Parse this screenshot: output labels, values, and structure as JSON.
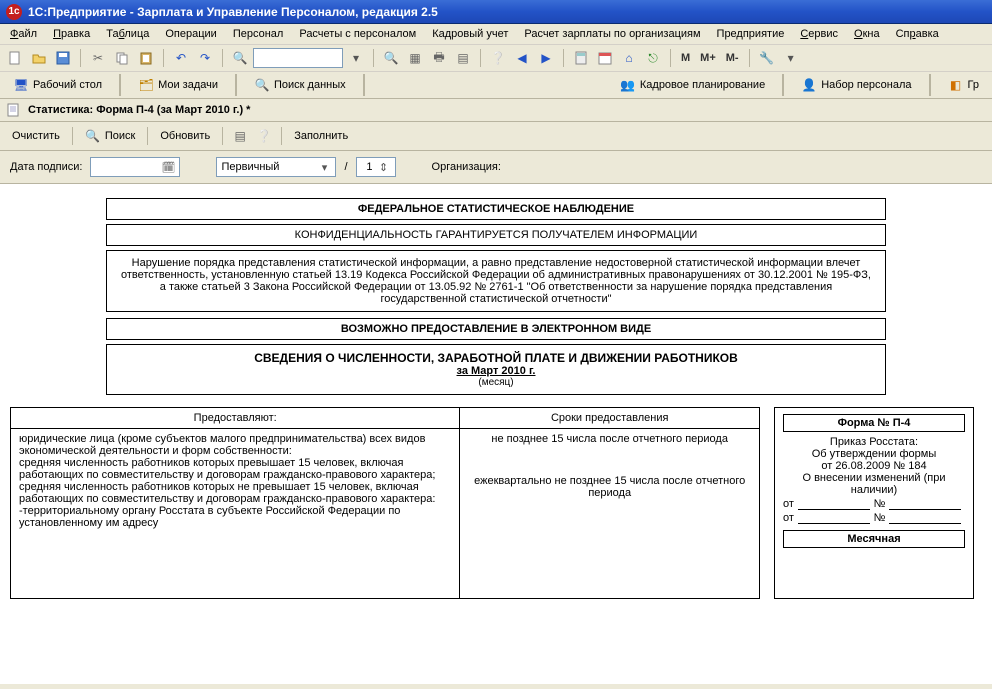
{
  "title": "1С:Предприятие - Зарплата и Управление Персоналом, редакция 2.5",
  "menu": {
    "file": "Файл",
    "edit": "Правка",
    "table": "Таблица",
    "operations": "Операции",
    "personnel": "Персонал",
    "calc": "Расчеты с персоналом",
    "hr": "Кадровый учет",
    "payroll": "Расчет зарплаты по организациям",
    "enterprise": "Предприятие",
    "service": "Сервис",
    "windows": "Окна",
    "help": "Справка"
  },
  "toolbar_text": {
    "m": "M",
    "mplus": "M+",
    "mminus": "M-"
  },
  "tabs": {
    "desktop": "Рабочий стол",
    "docs": "Мои задачи",
    "search": "Поиск данных",
    "hr_plan": "Кадровое планирование",
    "recruit": "Набор персонала",
    "gr": "Гр"
  },
  "doc": {
    "title": "Статистика: Форма П-4 (за Март 2010 г.) *",
    "clear": "Очистить",
    "search": "Поиск",
    "refresh": "Обновить",
    "fill": "Заполнить",
    "sign_date_label": "Дата подписи:",
    "sign_date": "",
    "correction_type": "Первичный",
    "slash": "/",
    "correction_num": "1",
    "org_label": "Организация:"
  },
  "report": {
    "box1": "ФЕДЕРАЛЬНОЕ СТАТИСТИЧЕСКОЕ НАБЛЮДЕНИЕ",
    "box2": "КОНФИДЕНЦИАЛЬНОСТЬ ГАРАНТИРУЕТСЯ ПОЛУЧАТЕЛЕМ ИНФОРМАЦИИ",
    "note": "Нарушение порядка представления статистической информации, а равно представление недостоверной статистической информации влечет ответственность, установленную статьей 13.19 Кодекса Российской Федерации об административных правонарушениях от 30.12.2001 № 195-ФЗ, а также статьей 3 Закона Российской Федерации от 13.05.92 № 2761-1 \"Об ответственности за нарушение порядка представления государственной статистической отчетности\"",
    "box3": "ВОЗМОЖНО ПРЕДОСТАВЛЕНИЕ В ЭЛЕКТРОННОМ ВИДЕ",
    "heading_title": "СВЕДЕНИЯ О ЧИСЛЕННОСТИ, ЗАРАБОТНОЙ ПЛАТЕ И ДВИЖЕНИИ РАБОТНИКОВ",
    "heading_period": "за Март 2010 г.",
    "heading_sub": "(месяц)",
    "col1_hdr": "Предоставляют:",
    "col2_hdr": "Сроки предоставления",
    "col1_body": "юридические лица (кроме субъектов малого предпринимательства) всех видов экономической деятельности и форм собственности:\n  средняя численность работников которых превышает 15 человек, включая работающих по совместительству и договорам гражданско-правового характера;\n  средняя численность работников которых не превышает 15 человек, включая работающих по совместительству и договорам гражданско-правового характера:\n    -территориальному органу Росстата в субъекте Российской Федерации по установленному им адресу",
    "col2_body1": "не позднее 15 числа после отчетного периода",
    "col2_body2": "ежеквартально не позднее 15 числа после отчетного периода",
    "form_meta": {
      "form_no": "Форма № П-4",
      "order": "Приказ Росстата:",
      "approval": "Об утверждении формы",
      "date": "от 26.08.2009 № 184",
      "changes": "О внесении изменений (при наличии)",
      "ot": "от",
      "no": "№",
      "monthly": "Месячная"
    }
  }
}
